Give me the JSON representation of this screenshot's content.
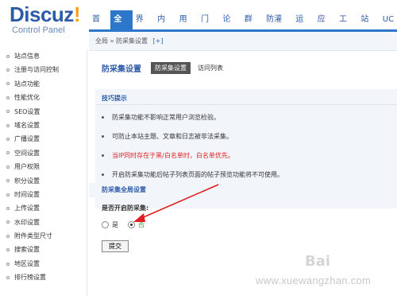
{
  "logo": {
    "main": "Discuz",
    "bang": "!",
    "sub": "Control Panel"
  },
  "nav": [
    "首页",
    "全局",
    "界面",
    "内容",
    "用户",
    "门户",
    "论坛",
    "群组",
    "防灌水",
    "运营",
    "应用",
    "工具",
    "站长",
    "UC"
  ],
  "nav_active_index": 1,
  "breadcrumb": {
    "path": "全局 » 防采集设置",
    "plus": "[+]"
  },
  "sidebar": [
    "站点信息",
    "注册与访问控制",
    "站点功能",
    "性能优化",
    "SEO设置",
    "域名设置",
    "广播设置",
    "空间设置",
    "用户权限",
    "积分设置",
    "时间设置",
    "上传设置",
    "水印设置",
    "附件类型尺寸",
    "搜索设置",
    "地区设置",
    "排行榜设置"
  ],
  "page": {
    "title": "防采集设置",
    "tab_active": "防采集设置",
    "tab_other": "访问列表",
    "tips_title": "技巧提示",
    "tips": [
      {
        "text": "防采集功能不影响正常用户浏览检验。",
        "red": false
      },
      {
        "text": "可防止本站主题、文章和日志被非法采集。",
        "red": false
      },
      {
        "text": "当IP同时存在于黑/白名单时，白名单优先。",
        "red": true
      },
      {
        "text": "开启防采集功能后帖子列表页面的帖子预览功能将不可使用。",
        "red": false
      }
    ],
    "section_title": "防采集全局设置",
    "field_label": "是否开启防采集:",
    "options": {
      "yes": "是",
      "no": "否",
      "selected": "否"
    },
    "submit": "提交"
  },
  "watermark": {
    "text": "www.xuewangzhan.com",
    "logo": "Bai"
  },
  "colors": {
    "brand": "#2c5ba8",
    "nav_active": "#2c77c9",
    "warning": "#e02020",
    "option_green": "#2a9a2a",
    "annotation": "#e02020"
  }
}
